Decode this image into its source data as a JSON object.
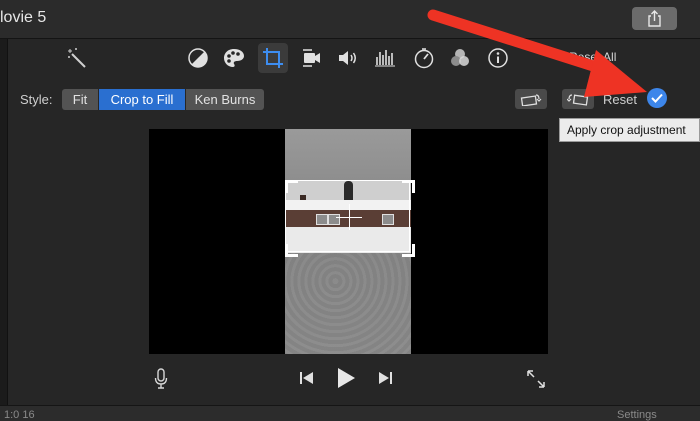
{
  "window": {
    "title": "lovie 5"
  },
  "toolbar": {
    "tools": [
      "magic-wand",
      "color-balance",
      "color-correction",
      "crop",
      "stabilization",
      "volume",
      "noise-reduction",
      "speed",
      "video-filter",
      "info"
    ],
    "active_tool": "crop",
    "reset_all_label": "Reset All"
  },
  "crop_panel": {
    "style_label": "Style:",
    "styles": [
      "Fit",
      "Crop to Fill",
      "Ken Burns"
    ],
    "selected_style": "Crop to Fill",
    "reset_label": "Reset",
    "apply_tooltip": "Apply crop adjustment"
  },
  "bottombar": {
    "left_text": "1:0 16",
    "right_text": "Settings"
  },
  "colors": {
    "accent": "#2a6fd0",
    "apply": "#3d86ea",
    "annotation_arrow": "#ee3324"
  }
}
